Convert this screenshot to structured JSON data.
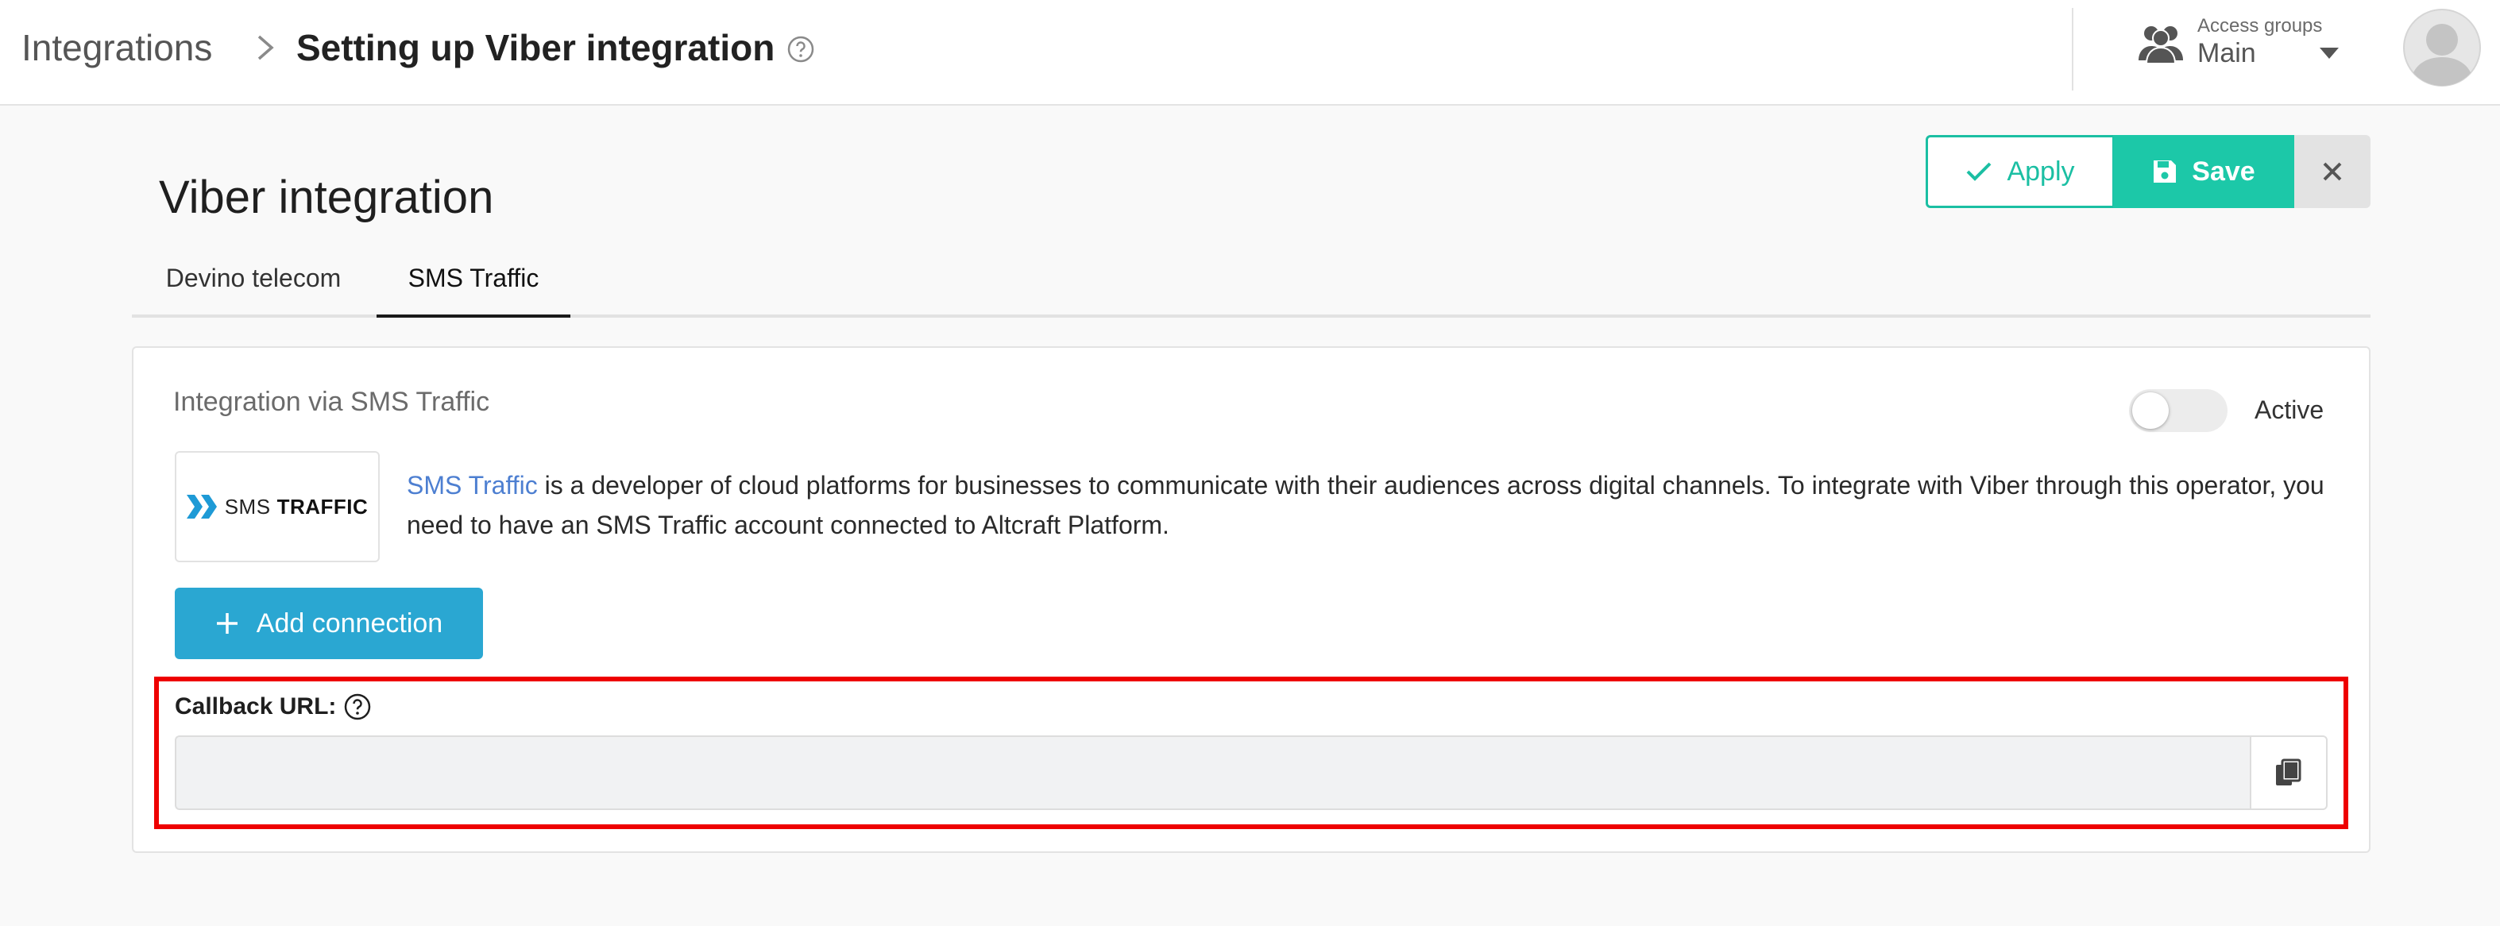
{
  "header": {
    "breadcrumb_root": "Integrations",
    "breadcrumb_current": "Setting up Viber integration",
    "access_groups_label": "Access groups",
    "access_groups_value": "Main"
  },
  "actions": {
    "apply_label": "Apply",
    "save_label": "Save"
  },
  "page": {
    "title": "Viber integration",
    "tabs": [
      {
        "label": "Devino telecom",
        "active": false
      },
      {
        "label": "SMS Traffic",
        "active": true
      }
    ]
  },
  "card": {
    "heading": "Integration via SMS Traffic",
    "active_label": "Active",
    "active": false,
    "logo_sms": "SMS",
    "logo_traffic": "TRAFFIC",
    "description_link": "SMS Traffic",
    "description_text": " is a developer of cloud platforms for businesses to communicate with their audiences across digital channels. To integrate with Viber through this operator, you need to have an SMS Traffic account connected to Altcraft Platform.",
    "add_connection_label": "Add connection",
    "callback_label": "Callback URL:",
    "callback_value": ""
  },
  "colors": {
    "accent_teal": "#1cc8a8",
    "add_button_blue": "#2aa7d2",
    "link_blue": "#4d7fd1",
    "highlight_red": "#ee0000"
  },
  "icons": [
    "chevron-right-icon",
    "help-circle-icon",
    "users-icon",
    "caret-down-icon",
    "user-avatar-icon",
    "check-icon",
    "floppy-disk-icon",
    "close-icon",
    "sms-traffic-logo-icon",
    "plus-icon",
    "copy-icon"
  ]
}
